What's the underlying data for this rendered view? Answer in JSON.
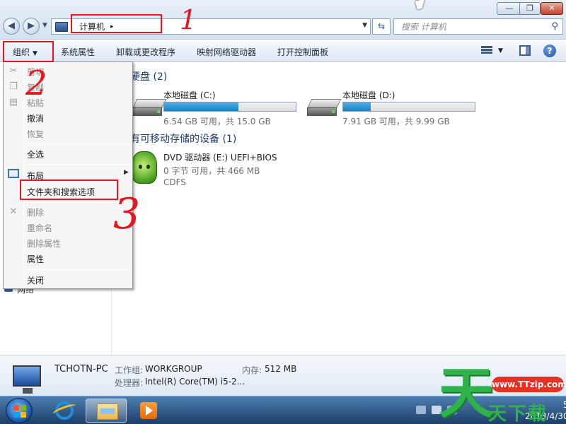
{
  "window": {
    "minimize_glyph": "—",
    "maximize_glyph": "❐",
    "close_glyph": "✕"
  },
  "address": {
    "path": "计算机",
    "separator": "▸",
    "back_glyph": "◀",
    "forward_glyph": "▶"
  },
  "search": {
    "placeholder": "搜索 计算机"
  },
  "toolbar": {
    "organize": "组织",
    "system_properties": "系统属性",
    "uninstall": "卸载或更改程序",
    "map_drive": "映射网络驱动器",
    "control_panel": "打开控制面板",
    "help": "?"
  },
  "sections": {
    "hdd": "硬盘 (2)",
    "removable": "有可移动存储的设备 (1)"
  },
  "drives": [
    {
      "name": "本地磁盘 (C:)",
      "space": "6.54 GB 可用，共 15.0 GB",
      "used_fraction": 0.564
    },
    {
      "name": "本地磁盘 (D:)",
      "space": "7.91 GB 可用，共 9.99 GB",
      "used_fraction": 0.208
    }
  ],
  "dvd": {
    "name": "DVD 驱动器 (E:) UEFI+BIOS",
    "space": "0 字节 可用，共 466 MB",
    "fs": "CDFS"
  },
  "menu": {
    "cut": "剪切",
    "copy": "复制",
    "paste": "粘贴",
    "undo": "撤消",
    "redo": "恢复",
    "select_all": "全选",
    "layout": "布局",
    "folder_options": "文件夹和搜索选项",
    "delete": "删除",
    "rename": "重命名",
    "remove_properties": "删除属性",
    "properties": "属性",
    "close": "关闭"
  },
  "nav": {
    "network": "网络"
  },
  "details": {
    "pc_name": "TCHOTN-PC",
    "workgroup_label": "工作组:",
    "workgroup": "WORKGROUP",
    "memory_label": "内存:",
    "memory": "512 MB",
    "cpu_label": "处理器:",
    "cpu": "Intel(R) Core(TM) i5-2..."
  },
  "annotations": {
    "one": "1",
    "two": "2",
    "three": "3"
  },
  "taskbar": {
    "time": "5",
    "date": "2013/4/30"
  },
  "watermark": {
    "site": "www.TTzip.com",
    "big": "天",
    "sub": "天下载"
  },
  "colors": {
    "annotation_red": "#e8151f",
    "drive_fill": "#1d7fc2",
    "watermark_green": "#2fb24a"
  }
}
